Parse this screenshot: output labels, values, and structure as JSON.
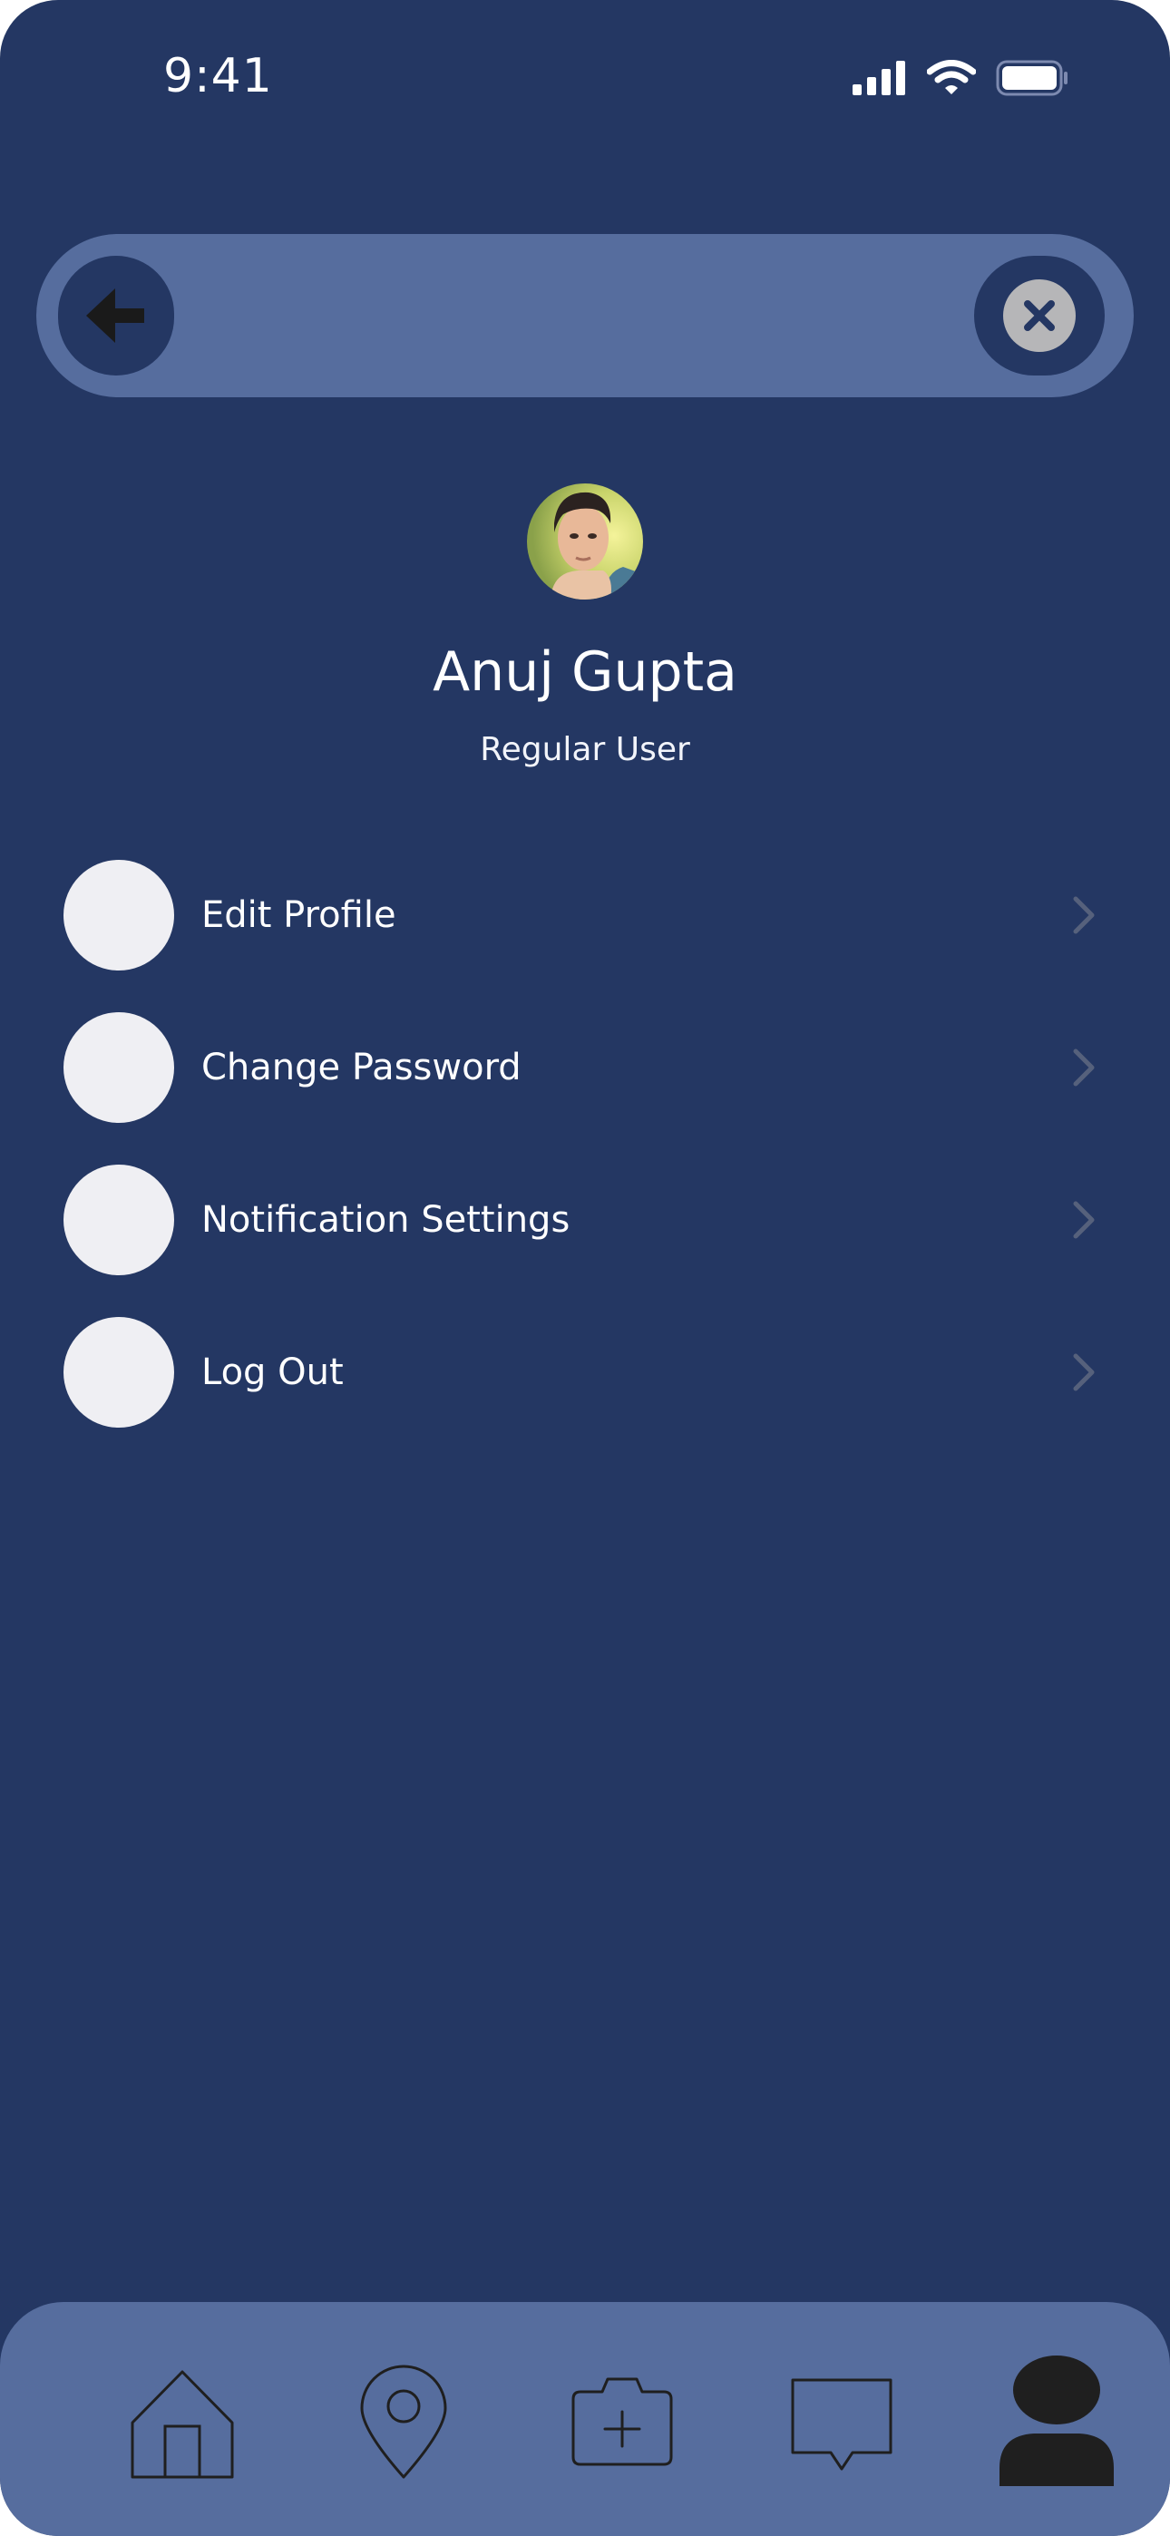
{
  "status_bar": {
    "time": "9:41"
  },
  "top_bar": {
    "back_icon": "arrow-left-icon",
    "close_icon": "close-circle-icon"
  },
  "profile": {
    "name": "Anuj Gupta",
    "role": "Regular User",
    "avatar": "user-photo"
  },
  "menu": {
    "items": [
      {
        "label": "Edit Profile",
        "icon": "placeholder-circle"
      },
      {
        "label": "Change Password",
        "icon": "placeholder-circle"
      },
      {
        "label": "Notification Settings",
        "icon": "placeholder-circle"
      },
      {
        "label": "Log Out",
        "icon": "placeholder-circle"
      }
    ]
  },
  "bottom_nav": {
    "items": [
      {
        "icon": "home-icon"
      },
      {
        "icon": "location-pin-icon"
      },
      {
        "icon": "add-photo-icon"
      },
      {
        "icon": "chat-icon"
      },
      {
        "icon": "profile-icon",
        "active": true
      }
    ]
  },
  "colors": {
    "background": "#243763",
    "bar": "#566d9e",
    "menu_circle": "#efeff3",
    "chevron": "#56617c",
    "icon_dark": "#1f1f1f"
  }
}
